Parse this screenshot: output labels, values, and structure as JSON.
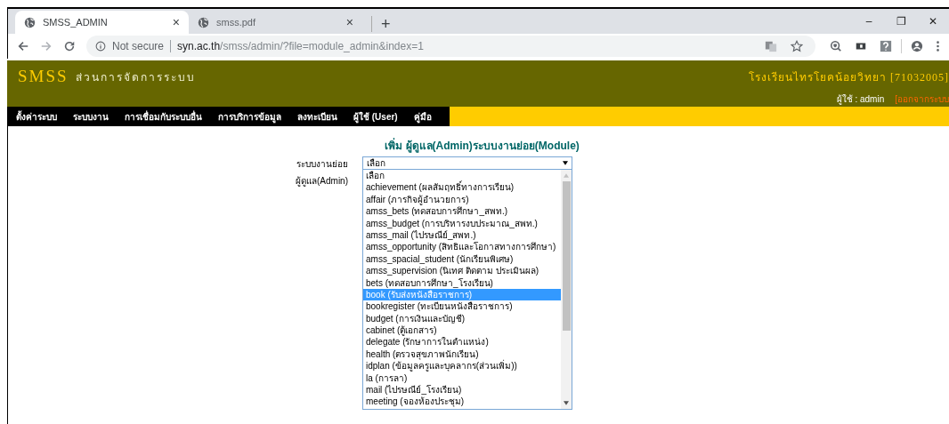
{
  "browser": {
    "tabs": [
      {
        "title": "SMSS_ADMIN",
        "close": "×",
        "selected": true
      },
      {
        "title": "smss.pdf",
        "close": "×",
        "selected": false
      }
    ],
    "new_tab": "+",
    "window_controls": [
      "–",
      "❐",
      "✕"
    ],
    "security": "Not secure",
    "url_host": "syn.ac.th",
    "url_path": "/smss/admin/?file=module_admin&index=1"
  },
  "header": {
    "logo": "SMSS",
    "title": "ส่วนการจัดการระบบ",
    "school": "โรงเรียนไทรโยคน้อยวิทยา [71032005]",
    "user": "ผู้ใช้ : admin",
    "logout": "[ออกจากระบบ"
  },
  "menu": [
    "ตั้งค่าระบบ",
    "ระบบงาน",
    "การเชื่อมกับระบบอื่น",
    "การบริการข้อมูล",
    "ลงทะเบียน",
    "ผู้ใช้ (User)",
    "คู่มือ"
  ],
  "form": {
    "heading": "เพิ่ม ผู้ดูแล(Admin)ระบบงานย่อย(Module)",
    "module_label": "ระบบงานย่อย",
    "module_value": "เลือก",
    "admin_label": "ผู้ดูแล(Admin)",
    "options": [
      {
        "label": "เลือก",
        "selected": false
      },
      {
        "label": "achievement (ผลสัมฤทธิ์ทางการเรียน)",
        "selected": false
      },
      {
        "label": "affair (ภารกิจผู้อำนวยการ)",
        "selected": false
      },
      {
        "label": "amss_bets (ทดสอบการศึกษา_สพท.)",
        "selected": false
      },
      {
        "label": "amss_budget (การบริหารงบประมาณ_สพท.)",
        "selected": false
      },
      {
        "label": "amss_mail (ไปรษณีย์_สพท.)",
        "selected": false
      },
      {
        "label": "amss_opportunity (สิทธิและโอกาสทางการศึกษา)",
        "selected": false
      },
      {
        "label": "amss_spacial_student (นักเรียนพิเศษ)",
        "selected": false
      },
      {
        "label": "amss_supervision (นิเทศ ติดตาม ประเมินผล)",
        "selected": false
      },
      {
        "label": "bets (ทดสอบการศึกษา_โรงเรียน)",
        "selected": false
      },
      {
        "label": "book (รับส่งหนังสือราชการ)",
        "selected": true
      },
      {
        "label": "bookregister (ทะเบียนหนังสือราชการ)",
        "selected": false
      },
      {
        "label": "budget (การเงินและบัญชี)",
        "selected": false
      },
      {
        "label": "cabinet (ตู้เอกสาร)",
        "selected": false
      },
      {
        "label": "delegate (รักษาการในตำแหน่ง)",
        "selected": false
      },
      {
        "label": "health (ตรวจสุขภาพนักเรียน)",
        "selected": false
      },
      {
        "label": "idplan (ข้อมูลครูและบุคลากร(ส่วนเพิ่ม))",
        "selected": false
      },
      {
        "label": "la (การลา)",
        "selected": false
      },
      {
        "label": "mail (ไปรษณีย์_โรงเรียน)",
        "selected": false
      },
      {
        "label": "meeting (จองห้องประชุม)",
        "selected": false
      }
    ]
  }
}
